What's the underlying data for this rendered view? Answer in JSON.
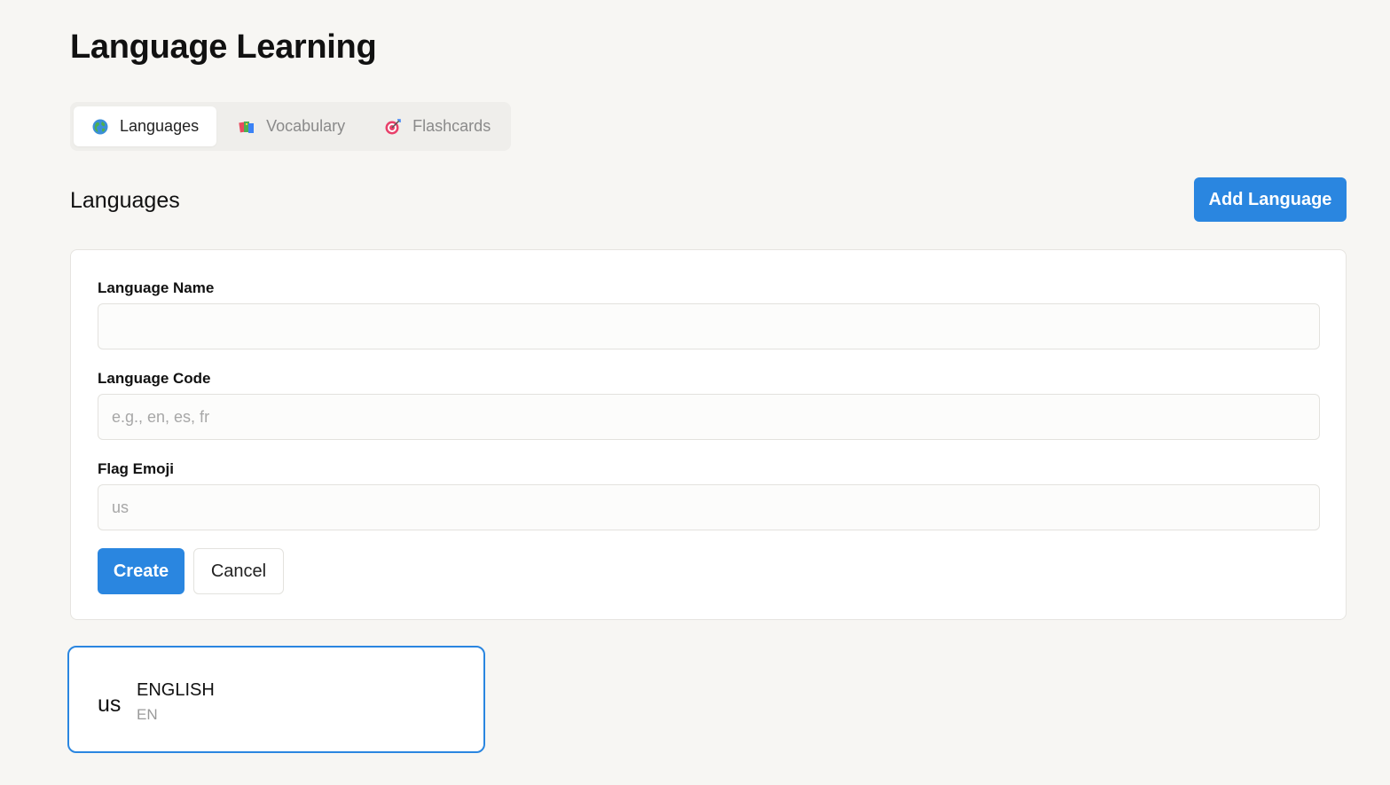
{
  "app": {
    "title": "Language Learning"
  },
  "tabs": [
    {
      "label": "Languages",
      "icon": "globe-icon",
      "active": true
    },
    {
      "label": "Vocabulary",
      "icon": "books-icon",
      "active": false
    },
    {
      "label": "Flashcards",
      "icon": "target-icon",
      "active": false
    }
  ],
  "section": {
    "title": "Languages",
    "add_button": "Add Language"
  },
  "form": {
    "name_label": "Language Name",
    "name_value": "",
    "name_placeholder": "",
    "code_label": "Language Code",
    "code_value": "",
    "code_placeholder": "e.g., en, es, fr",
    "flag_label": "Flag Emoji",
    "flag_value": "",
    "flag_placeholder": "us",
    "create_button": "Create",
    "cancel_button": "Cancel"
  },
  "languages": [
    {
      "flag": "us",
      "name": "ENGLISH",
      "code": "EN",
      "selected": true
    }
  ],
  "colors": {
    "accent": "#2a86e0",
    "background": "#f7f6f3",
    "card": "#ffffff",
    "muted_text": "#8a8a8a"
  }
}
